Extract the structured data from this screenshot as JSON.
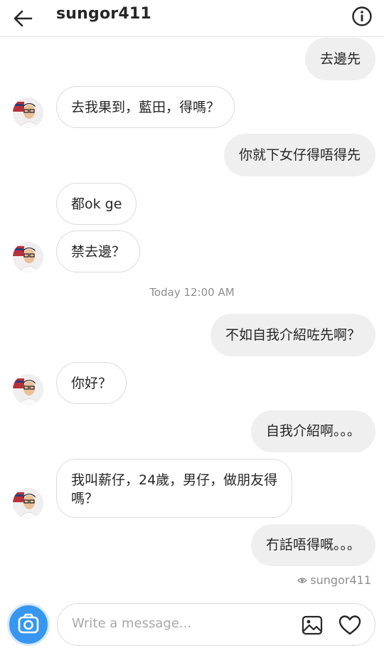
{
  "header": {
    "username": "sungor411",
    "back_icon": "arrow-left-icon",
    "info_icon": "info-icon"
  },
  "messages": [
    {
      "side": "out",
      "text": "去邊先"
    },
    {
      "side": "in",
      "text": "去我果到，藍田，得嗎？",
      "avatar": true
    },
    {
      "side": "out",
      "text": "你就下女仔得唔得先"
    },
    {
      "side": "in",
      "text": "都ok ge"
    },
    {
      "side": "in",
      "text": "禁去邊？",
      "avatar": true
    },
    {
      "side": "out",
      "text": "不如自我介紹咗先啊？"
    },
    {
      "side": "in",
      "text": "你好？",
      "avatar": true
    },
    {
      "side": "out",
      "text": "自我介紹啊。。。"
    },
    {
      "side": "in",
      "text_line1": "我叫薪仔，24歲，男仔，做朋友得",
      "text_line2": "嗎？",
      "avatar": true
    },
    {
      "side": "out",
      "text": "冇話唔得嘅。。。"
    }
  ],
  "timestamp": "Today 12:00 AM",
  "seen": {
    "label": "sungor411",
    "icon": "eye-icon"
  },
  "composer": {
    "placeholder": "Write a message...",
    "camera_icon": "camera-icon",
    "gallery_icon": "image-icon",
    "like_icon": "heart-icon",
    "accent_color": "#3797f0"
  }
}
